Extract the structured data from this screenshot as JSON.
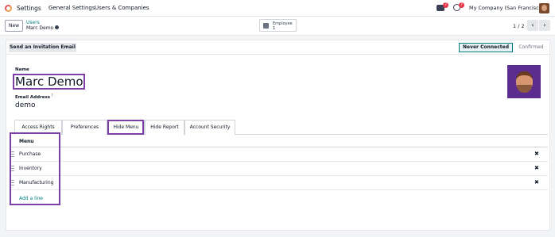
{
  "navbar": {
    "app_name": "Settings",
    "menus": [
      "General Settings",
      "Users & Companies"
    ],
    "chat_icon": "chat-icon",
    "chat_count": "7",
    "activity_icon": "clock-icon",
    "activity_count": "7",
    "company": "My Company (San Francisco)"
  },
  "control": {
    "new_label": "New",
    "breadcrumb_parent": "Users",
    "breadcrumb_current": "Marc Demo",
    "smart_button": {
      "label": "Employee",
      "value": "1"
    },
    "pager": "1 / 2",
    "prev": "‹",
    "next": "›"
  },
  "statusbar": {
    "invite_label": "Send an Invitation Email",
    "stages": [
      "Never Connected",
      "Confirmed"
    ],
    "active_stage": "Never Connected"
  },
  "form": {
    "name_label": "Name",
    "name_value": "Marc Demo",
    "email_label": "Email Address",
    "email_help": "?",
    "email_value": "demo"
  },
  "tabs": [
    "Access Rights",
    "Preferences",
    "Hide Menu",
    "Hide Report",
    "Account Security"
  ],
  "active_tab": "Hide Menu",
  "menu_table": {
    "header": "Menu",
    "rows": [
      "Purchase",
      "Inventory",
      "Manufacturing"
    ],
    "remove_glyph": "✖",
    "add_line": "Add a line"
  },
  "colors": {
    "accent": "#017e84",
    "highlight": "#7b3fa6",
    "badge": "#e5384b"
  }
}
